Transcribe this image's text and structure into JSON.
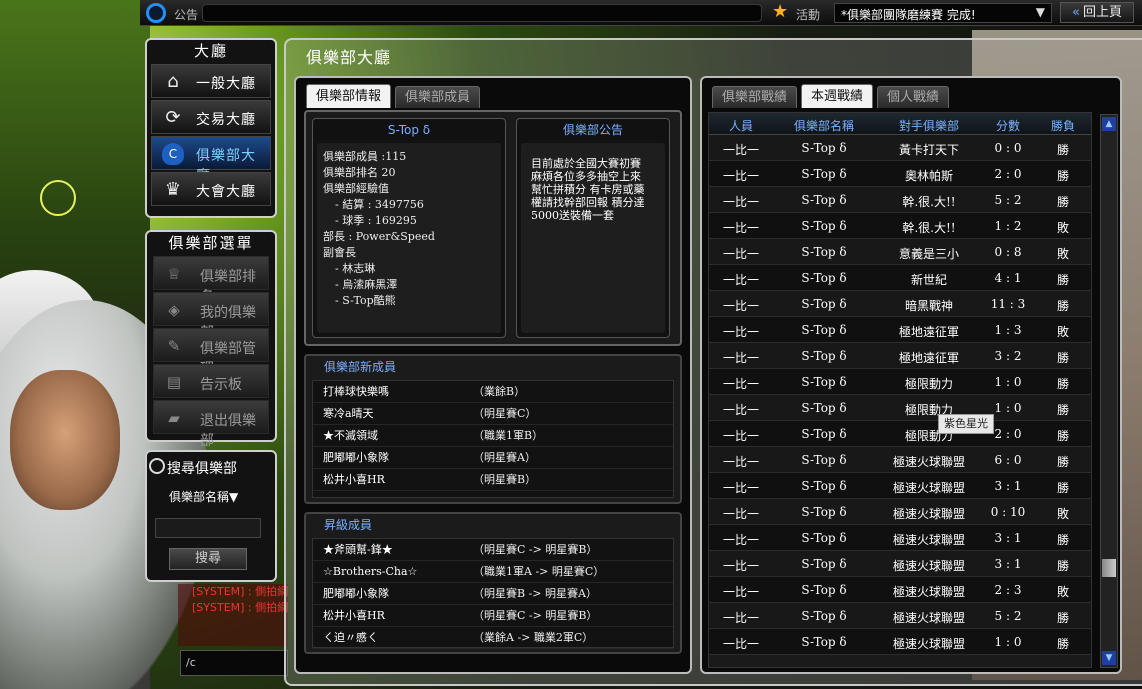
{
  "topbar": {
    "announce_label": "公告",
    "activity_label": "活動",
    "activity_selected": "*俱樂部團隊磨練賽 完成!",
    "back_label": "回上頁"
  },
  "hall": {
    "title": "大廳",
    "items": [
      {
        "label": "一般大廳",
        "icon": "home-icon"
      },
      {
        "label": "交易大廳",
        "icon": "exchange-icon"
      },
      {
        "label": "俱樂部大廳",
        "icon": "club-shield-icon",
        "active": true
      },
      {
        "label": "大會大廳",
        "icon": "trophy-icon"
      }
    ]
  },
  "club_menu": {
    "title": "俱樂部選單",
    "items": [
      {
        "label": "俱樂部排名"
      },
      {
        "label": "我的俱樂部"
      },
      {
        "label": "俱樂部管理"
      },
      {
        "label": "告示板"
      },
      {
        "label": "退出俱樂部"
      }
    ]
  },
  "search": {
    "title": "搜尋俱樂部",
    "type": "俱樂部名稱▼",
    "button": "搜尋"
  },
  "chat": {
    "lines": [
      "[SYSTEM] : 側拍網",
      "[SYSTEM] : 側拍網"
    ],
    "input": "/c"
  },
  "main": {
    "title": "俱樂部大廳"
  },
  "left_tabs": [
    "俱樂部情報",
    "俱樂部成員"
  ],
  "club_info": {
    "name": "S-Top δ",
    "lines": [
      {
        "text": "俱樂部成員 :115",
        "indent": false
      },
      {
        "text": "俱樂部排名 20",
        "indent": false
      },
      {
        "text": "俱樂部經驗值",
        "indent": false
      },
      {
        "text": "- 結算 :   3497756",
        "indent": true
      },
      {
        "text": "- 球季 :   169295",
        "indent": true
      },
      {
        "text": "部長 :  Power&Speed",
        "indent": false
      },
      {
        "text": "副會長",
        "indent": false
      },
      {
        "text": "- 林志琳",
        "indent": true
      },
      {
        "text": "- 烏溹麻黑澤",
        "indent": true
      },
      {
        "text": "- S-Top酷熊",
        "indent": true
      }
    ]
  },
  "club_notice": {
    "title": "俱樂部公告",
    "text": "目前處於全國大賽初賽 麻煩各位多多抽空上來 幫忙拼積分 有卡房或藥 權請找幹部回報 積分達 5000送裝備一套"
  },
  "new_members": {
    "title": "俱樂部新成員",
    "rows": [
      {
        "name": "打棒球快樂嗎",
        "rank": "（業餘B）"
      },
      {
        "name": "寒冷a晴天",
        "rank": "（明星賽C）"
      },
      {
        "name": "★不滅領域",
        "rank": "（職業1軍B）"
      },
      {
        "name": "肥嘟嘟小象隊",
        "rank": "（明星賽A）"
      },
      {
        "name": "松井小喜HR",
        "rank": "（明星賽B）"
      }
    ]
  },
  "promoted": {
    "title": "昇級成員",
    "rows": [
      {
        "name": "★斧頭幫-鋒★",
        "rank": "（明星賽C -> 明星賽B）"
      },
      {
        "name": "☆Brothers-Cha☆",
        "rank": "（職業1軍A -> 明星賽C）"
      },
      {
        "name": "肥嘟嘟小象隊",
        "rank": "（明星賽B -> 明星賽A）"
      },
      {
        "name": "松井小喜HR",
        "rank": "（明星賽C -> 明星賽B）"
      },
      {
        "name": "ㄑ迫〃慼ㄑ",
        "rank": "（業餘A -> 職業2軍C）"
      }
    ]
  },
  "right_tabs": [
    "俱樂部戰績",
    "本週戰績",
    "個人戰績"
  ],
  "results_table": {
    "headers": [
      "人員",
      "俱樂部名稱",
      "對手俱樂部",
      "分數",
      "勝負"
    ],
    "rows": [
      [
        "一比一",
        "S-Top δ",
        "黃卡打天下",
        "0 : 0",
        "勝"
      ],
      [
        "一比一",
        "S-Top δ",
        "奧林帕斯",
        "2 : 0",
        "勝"
      ],
      [
        "一比一",
        "S-Top δ",
        "幹.很.大!!",
        "5 : 2",
        "勝"
      ],
      [
        "一比一",
        "S-Top δ",
        "幹.很.大!!",
        "1 : 2",
        "敗"
      ],
      [
        "一比一",
        "S-Top δ",
        "意義是三小",
        "0 : 8",
        "敗"
      ],
      [
        "一比一",
        "S-Top δ",
        "新世紀",
        "4 : 1",
        "勝"
      ],
      [
        "一比一",
        "S-Top δ",
        "暗黑戰神",
        "11 : 3",
        "勝"
      ],
      [
        "一比一",
        "S-Top δ",
        "極地遠征軍",
        "1 : 3",
        "敗"
      ],
      [
        "一比一",
        "S-Top δ",
        "極地遠征軍",
        "3 : 2",
        "勝"
      ],
      [
        "一比一",
        "S-Top δ",
        "極限動力",
        "1 : 0",
        "勝"
      ],
      [
        "一比一",
        "S-Top δ",
        "極限動力",
        "1 : 0",
        "勝"
      ],
      [
        "一比一",
        "S-Top δ",
        "極限動力",
        "2 : 0",
        "勝"
      ],
      [
        "一比一",
        "S-Top δ",
        "極速火球聯盟",
        "6 : 0",
        "勝"
      ],
      [
        "一比一",
        "S-Top δ",
        "極速火球聯盟",
        "3 : 1",
        "勝"
      ],
      [
        "一比一",
        "S-Top δ",
        "極速火球聯盟",
        "0 : 10",
        "敗"
      ],
      [
        "一比一",
        "S-Top δ",
        "極速火球聯盟",
        "3 : 1",
        "勝"
      ],
      [
        "一比一",
        "S-Top δ",
        "極速火球聯盟",
        "3 : 1",
        "勝"
      ],
      [
        "一比一",
        "S-Top δ",
        "極速火球聯盟",
        "2 : 3",
        "敗"
      ],
      [
        "一比一",
        "S-Top δ",
        "極速火球聯盟",
        "5 : 2",
        "勝"
      ],
      [
        "一比一",
        "S-Top δ",
        "極速火球聯盟",
        "1 : 0",
        "勝"
      ]
    ]
  },
  "tooltip": "紫色星光",
  "colors": {
    "accent_blue": "#7ab0ff",
    "active_nav": "#1e4a8c",
    "system_text": "#ee3333"
  }
}
